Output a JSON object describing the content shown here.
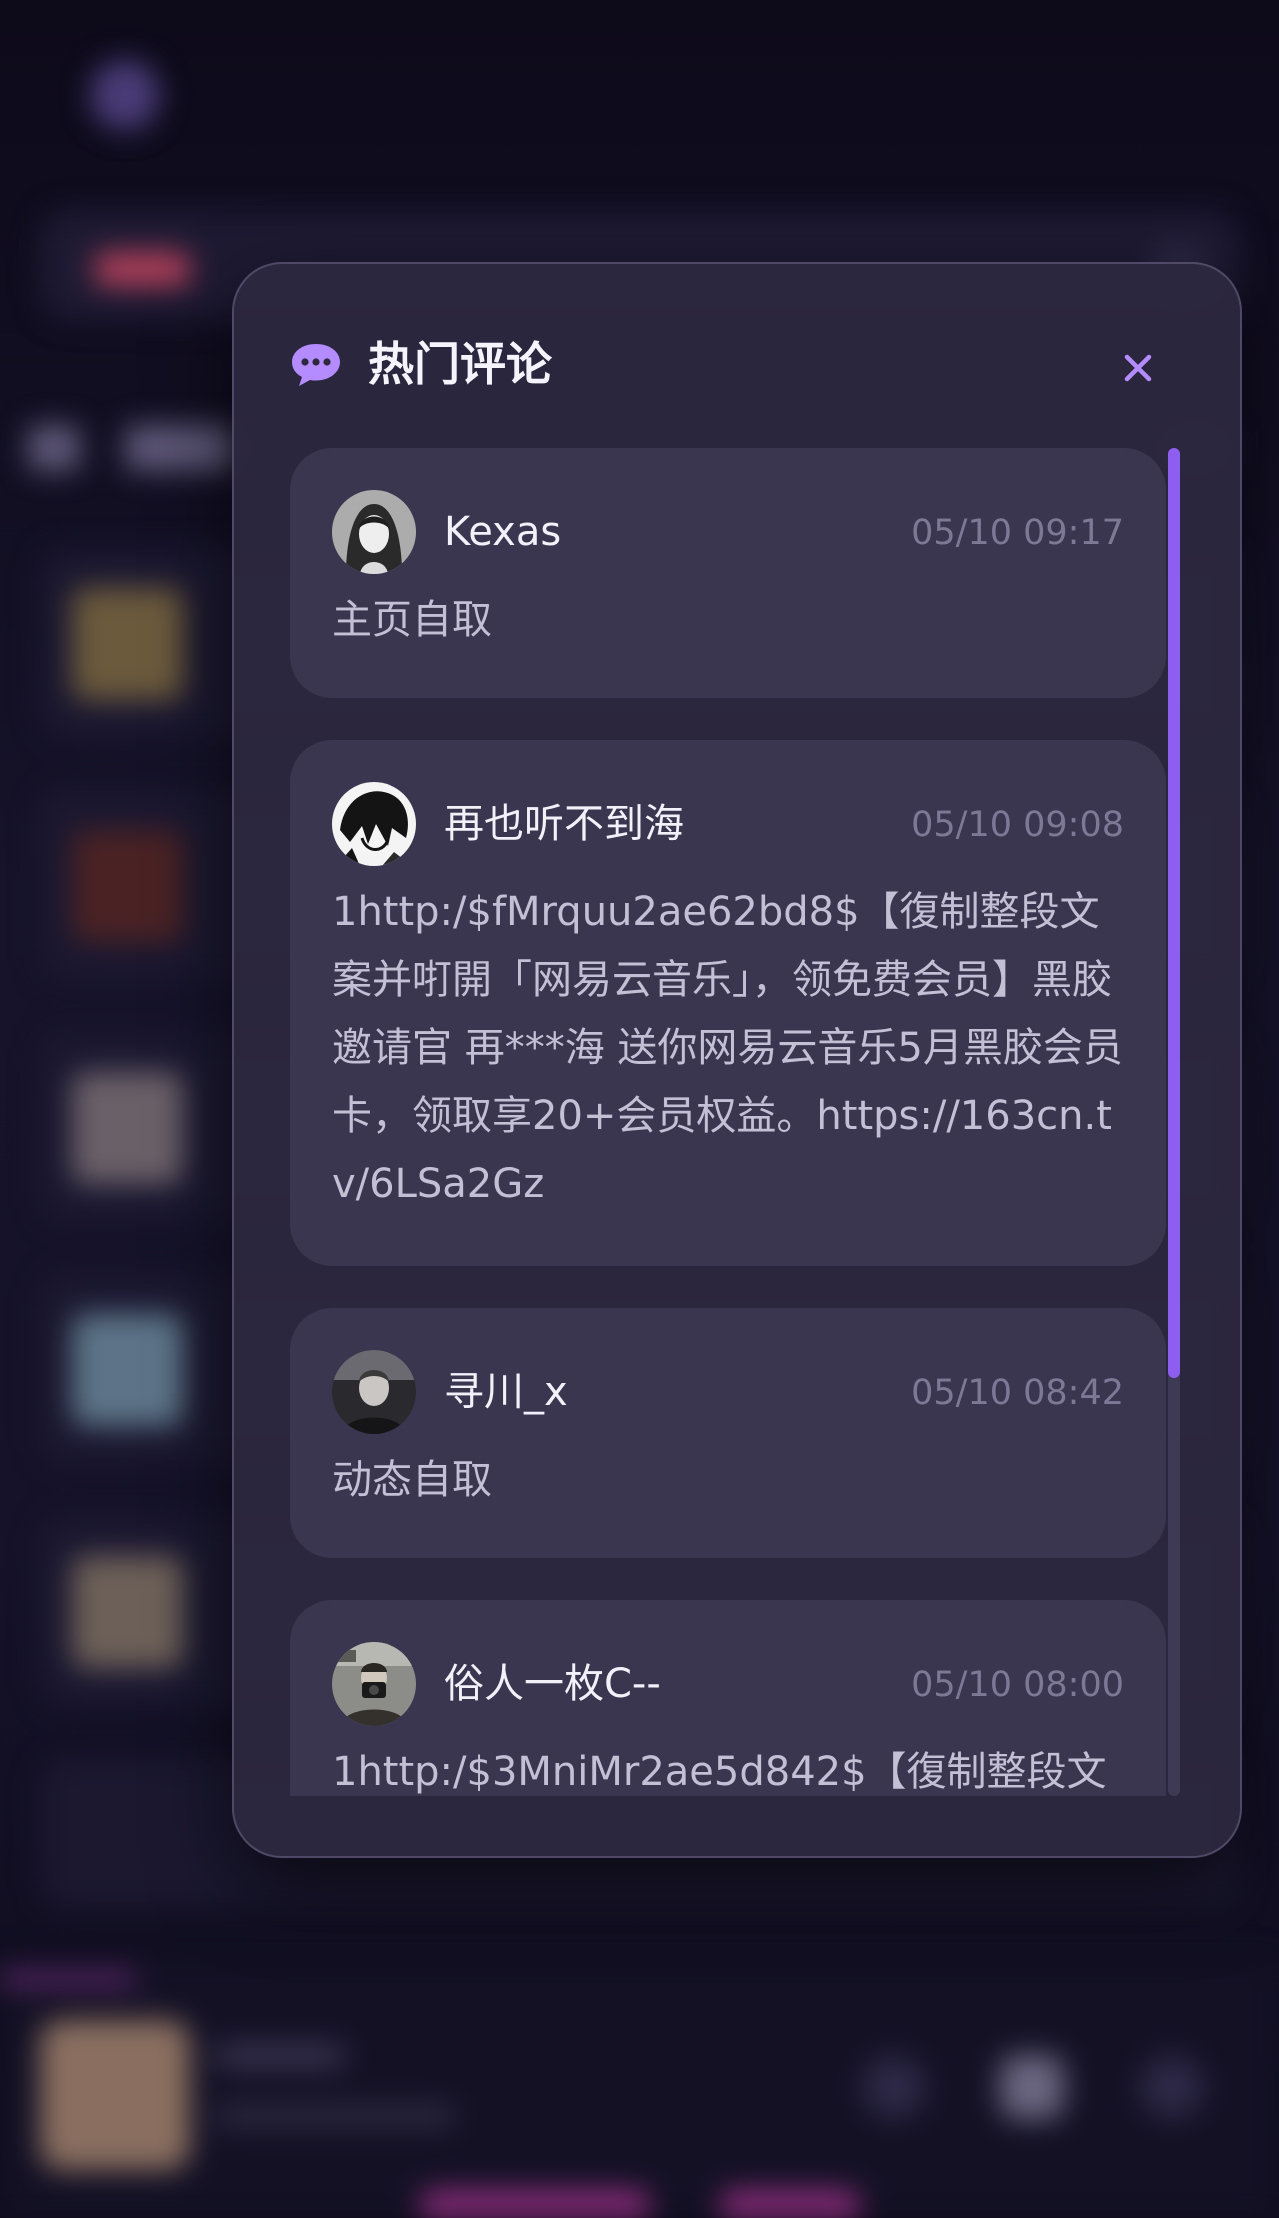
{
  "modal": {
    "title": "热门评论",
    "icon": "chat-bubble-icon",
    "close_icon": "close-icon",
    "accent_color": "#b48cff",
    "scroll_position": 0.0
  },
  "comments": [
    {
      "user": "Kexas",
      "time": "05/10 09:17",
      "text": "主页自取",
      "avatar": "avatar-girl-portrait"
    },
    {
      "user": "再也听不到海",
      "time": "05/10 09:08",
      "text": "1http:/$fMrquu2ae62bd8$【復制整段文案并咑開「网易云音乐」，领免费会员】黑胶邀请官 再***海 送你网易云音乐5月黑胶会员卡，领取享20+会员权益。https://163cn.tv/6LSa2Gz",
      "avatar": "avatar-manga-sketch"
    },
    {
      "user": "寻川_x",
      "time": "05/10 08:42",
      "text": "动态自取",
      "avatar": "avatar-man-portrait"
    },
    {
      "user": "俗人一枚C--",
      "time": "05/10 08:00",
      "text": "1http:/$3MniMr2ae5d842$【復制整段文",
      "avatar": "avatar-camera-photo"
    }
  ]
}
